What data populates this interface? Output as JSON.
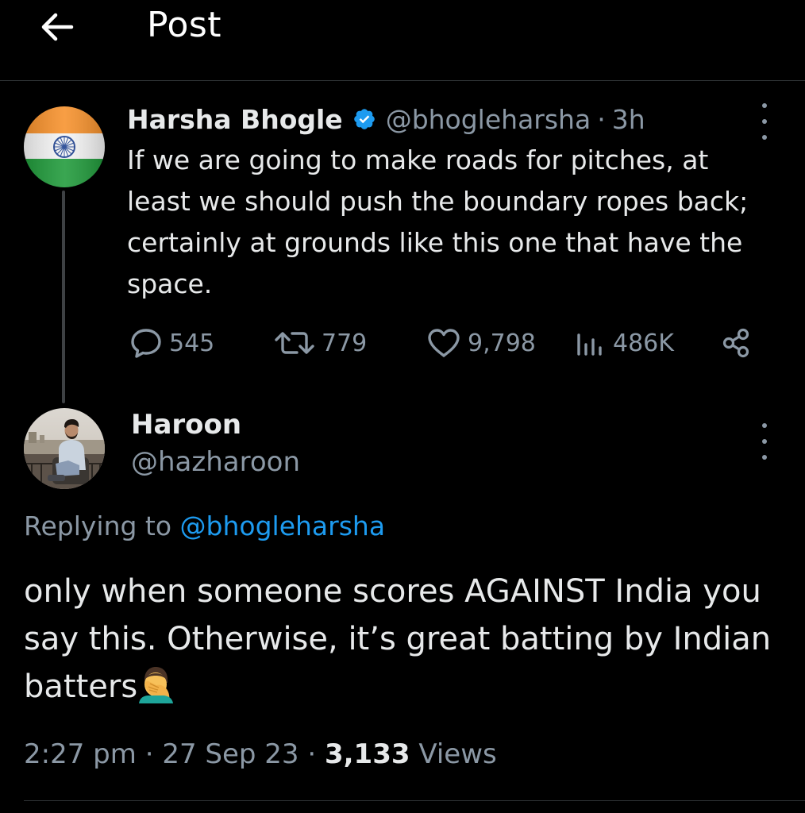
{
  "header": {
    "title": "Post",
    "back_icon": "arrow-left-icon"
  },
  "parent_post": {
    "author_name": "Harsha Bhogle",
    "verified": true,
    "handle": "@bhogleharsha",
    "separator": "·",
    "time": "3h",
    "text": "If we are going to make roads for pitches, at least we should push the boundary ropes back; certainly at grounds like this one that have the space.",
    "avatar_icon": "indian-flag-avatar",
    "actions": {
      "replies": "545",
      "reposts": "779",
      "likes": "9,798",
      "views": "486K"
    }
  },
  "reply_post": {
    "author_name": "Haroon",
    "handle": "@hazharoon",
    "replying_prefix": "Replying to",
    "replying_to": "@bhogleharsha",
    "text": "only when someone scores AGAINST India you say this. Otherwise, it’s great batting by Indian batters",
    "emoji_icon": "facepalm-emoji-icon",
    "timestamp": "2:27 pm",
    "date": "27 Sep 23",
    "separator": "·",
    "views_count": "3,133",
    "views_label": "Views"
  },
  "colors": {
    "background": "#000000",
    "primary_text": "#e7e9ea",
    "secondary_text": "#8b98a5",
    "link": "#1d9bf0",
    "verified": "#1d9bf0",
    "divider": "#2f3336"
  }
}
